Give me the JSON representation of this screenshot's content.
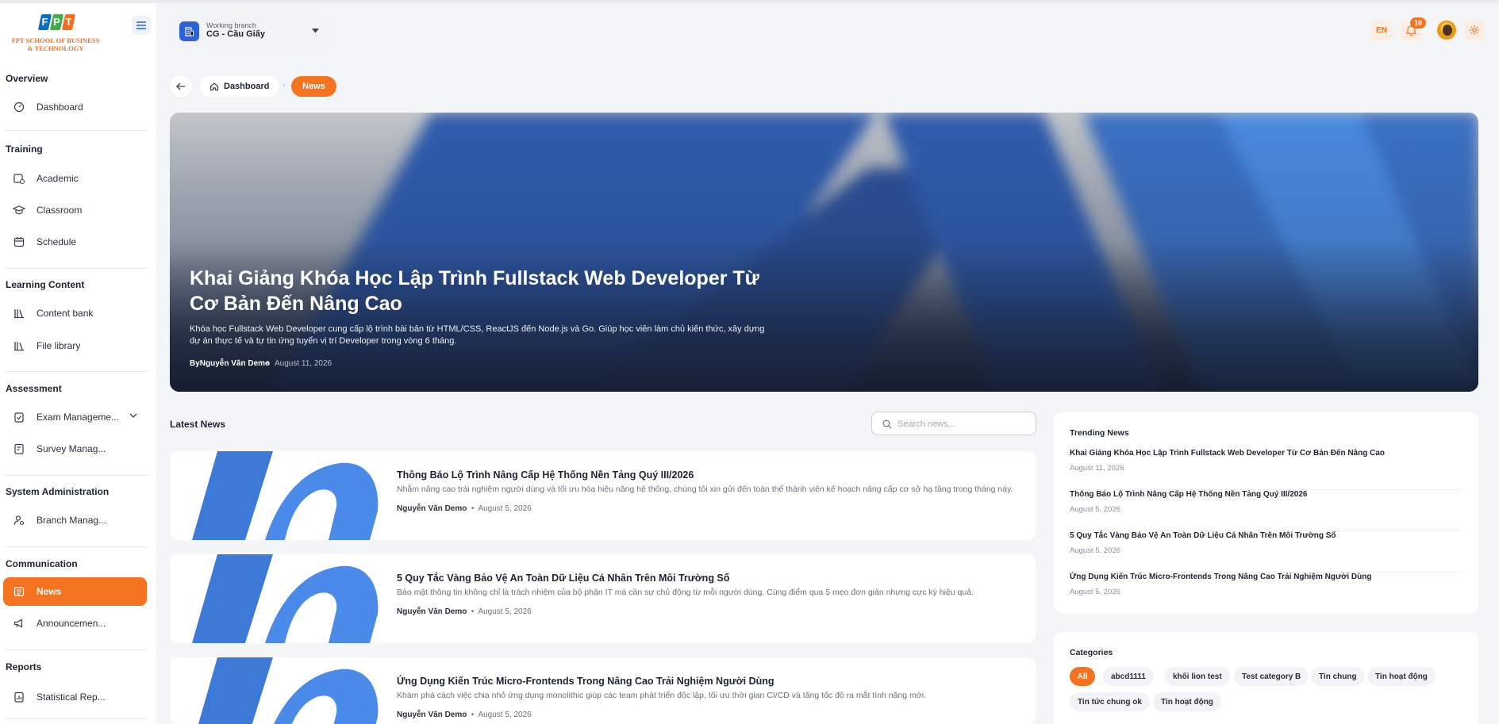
{
  "sidebar": {
    "logo": {
      "letters": [
        "F",
        "P",
        "T"
      ],
      "text_line1": "FPT SCHOOL OF BUSINESS",
      "text_line2": "& TECHNOLOGY"
    },
    "sections": {
      "overview": "Overview",
      "training": "Training",
      "learning": "Learning Content",
      "assessment": "Assessment",
      "sysadmin": "System Administration",
      "communication": "Communication",
      "reports": "Reports"
    },
    "items": {
      "dashboard": "Dashboard",
      "academic": "Academic",
      "classroom": "Classroom",
      "schedule": "Schedule",
      "content_bank": "Content bank",
      "file_library": "File library",
      "exam": "Exam Manageme...",
      "survey": "Survey Manag...",
      "branch": "Branch Manag...",
      "news": "News",
      "announcement": "Announcemen...",
      "statistical": "Statistical Rep..."
    }
  },
  "header": {
    "branch_label": "Working branch",
    "branch_value": "CG - Cầu Giấy",
    "lang": "EN",
    "notifications": "10"
  },
  "breadcrumb": {
    "home": "Dashboard",
    "current": "News"
  },
  "hero": {
    "title": "Khai Giảng Khóa Học Lập Trình Fullstack Web Developer Từ Cơ Bản Đến Nâng Cao",
    "description": "Khóa học Fullstack Web Developer cung cấp lộ trình bài bản từ HTML/CSS, ReactJS đến Node.js và Go. Giúp học viên làm chủ kiến thức, xây dựng dự án thực tế và tự tin ứng tuyển vị trí Developer trong vòng 6 tháng.",
    "author": "ByNguyễn Văn Demo",
    "separator": "•",
    "date": "August 11, 2026"
  },
  "latest": {
    "title": "Latest News",
    "search_placeholder": "Search news...",
    "articles": [
      {
        "title": "Thông Báo Lộ Trình Nâng Cấp Hệ Thống Nền Tảng Quý III/2026",
        "excerpt": "Nhằm nâng cao trải nghiệm người dùng và tối ưu hóa hiệu năng hệ thống, chúng tôi xin gửi đến toàn thể thành viên kế hoạch nâng cấp cơ sở hạ tầng trong tháng này.",
        "author": "Nguyễn Văn Demo",
        "sep": "•",
        "date": "August 5, 2026"
      },
      {
        "title": "5 Quy Tắc Vàng Bảo Vệ An Toàn Dữ Liệu Cá Nhân Trên Môi Trường Số",
        "excerpt": "Bảo mật thông tin không chỉ là trách nhiệm của bộ phận IT mà cần sự chủ động từ mỗi người dùng. Cùng điểm qua 5 mẹo đơn giản nhưng cực kỳ hiệu quả.",
        "author": "Nguyễn Văn Demo",
        "sep": "•",
        "date": "August 5, 2026"
      },
      {
        "title": "Ứng Dụng Kiến Trúc Micro-Frontends Trong Nâng Cao Trải Nghiệm Người Dùng",
        "excerpt": "Khám phá cách việc chia nhỏ ứng dụng monolithic giúp các team phát triển độc lập, tối ưu thời gian CI/CD và tăng tốc độ ra mắt tính năng mới.",
        "author": "Nguyễn Văn Demo",
        "sep": "•",
        "date": "August 5, 2026"
      }
    ]
  },
  "trending": {
    "title": "Trending News",
    "items": [
      {
        "title": "Khai Giảng Khóa Học Lập Trình Fullstack Web Developer Từ Cơ Bản Đến Nâng Cao",
        "date": "August 11, 2026"
      },
      {
        "title": "Thông Báo Lộ Trình Nâng Cấp Hệ Thống Nền Tảng Quý III/2026",
        "date": "August 5, 2026"
      },
      {
        "title": "5 Quy Tắc Vàng Bảo Vệ An Toàn Dữ Liệu Cá Nhân Trên Môi Trường Số",
        "date": "August 5, 2026"
      },
      {
        "title": "Ứng Dụng Kiến Trúc Micro-Frontends Trong Nâng Cao Trải Nghiệm Người Dùng",
        "date": "August 5, 2026"
      }
    ]
  },
  "categories": {
    "title": "Categories",
    "items": [
      "All",
      "abcd1111",
      "khối lion test",
      "Test category B",
      "Tin chung",
      "Tin hoạt động",
      "Tin tức chung ok",
      "Tin hoạt động"
    ]
  },
  "colors": {
    "accent": "#f47320",
    "brand_blue": "#2d63d7",
    "page_bg": "#f4f5f7"
  }
}
